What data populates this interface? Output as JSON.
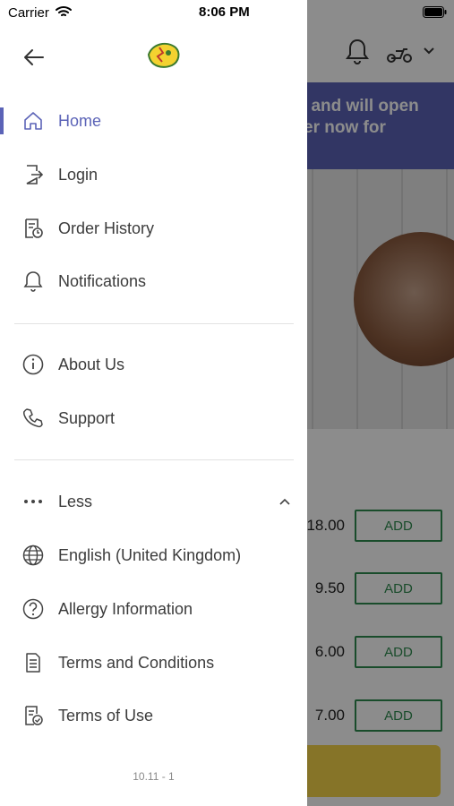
{
  "status_bar": {
    "carrier": "Carrier",
    "time": "8:06 PM"
  },
  "background": {
    "banner_lines": [
      "ed and will open",
      "rder now for"
    ],
    "products": [
      {
        "price": "18.00",
        "add_label": "ADD"
      },
      {
        "price": "9.50",
        "add_label": "ADD"
      },
      {
        "price": "6.00",
        "add_label": "ADD"
      },
      {
        "price": "7.00",
        "add_label": "ADD"
      }
    ]
  },
  "drawer": {
    "menu": [
      {
        "label": "Home",
        "icon": "home-icon"
      },
      {
        "label": "Login",
        "icon": "login-icon"
      },
      {
        "label": "Order History",
        "icon": "order-history-icon"
      },
      {
        "label": "Notifications",
        "icon": "bell-icon"
      }
    ],
    "menu2": [
      {
        "label": "About Us",
        "icon": "info-icon"
      },
      {
        "label": "Support",
        "icon": "phone-icon"
      }
    ],
    "less_label": "Less",
    "menu3": [
      {
        "label": "English (United Kingdom)",
        "icon": "globe-icon"
      },
      {
        "label": "Allergy Information",
        "icon": "question-icon"
      },
      {
        "label": "Terms and Conditions",
        "icon": "document-icon"
      },
      {
        "label": "Terms of Use",
        "icon": "document-check-icon"
      }
    ],
    "version": "10.11 - 1"
  },
  "colors": {
    "accent": "#5b63b7",
    "add_green": "#2f8a4f",
    "cta_yellow": "#f5d44a"
  }
}
